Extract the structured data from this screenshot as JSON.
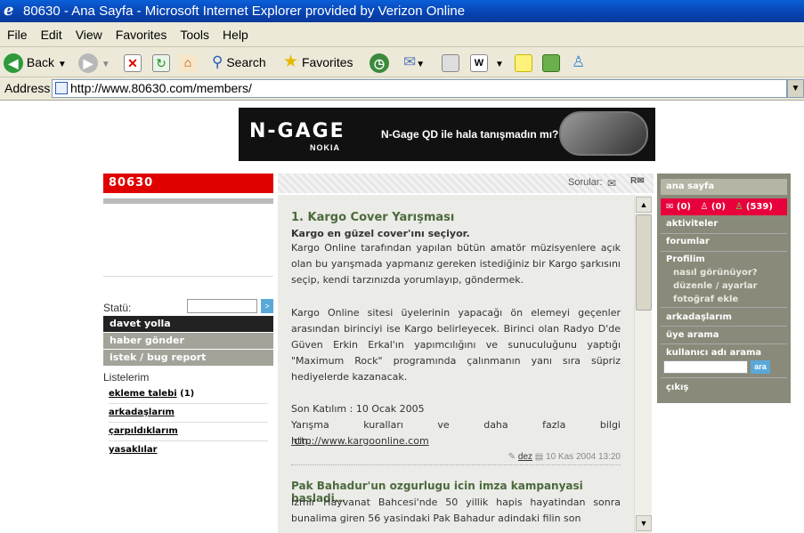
{
  "window": {
    "title": "80630 - Ana Sayfa - Microsoft Internet Explorer provided by Verizon Online"
  },
  "menu": [
    "File",
    "Edit",
    "View",
    "Favorites",
    "Tools",
    "Help"
  ],
  "toolbar": {
    "back": "Back",
    "search": "Search",
    "favorites": "Favorites"
  },
  "address": {
    "label": "Address",
    "url": "http://www.80630.com/members/"
  },
  "banner": {
    "logo": "N-GAGE",
    "brand": "NOKIA",
    "text": "N-Gage QD ile hala tanışmadın mı?"
  },
  "left": {
    "site_logo": "80630",
    "statu_label": "Statü:",
    "statu_btn": ">",
    "nav": [
      "davet yolla",
      "haber gönder",
      "istek / bug report"
    ],
    "listelerim": "Listelerim",
    "lists": [
      {
        "label": "ekleme talebi",
        "count": "(1)"
      },
      {
        "label": "arkadaşlarım",
        "count": ""
      },
      {
        "label": "çarpıldıklarım",
        "count": ""
      },
      {
        "label": "yasaklılar",
        "count": ""
      }
    ]
  },
  "center": {
    "sorular": "Sorular:",
    "articles": [
      {
        "title": "1. Kargo Cover Yarışması",
        "subtitle": "Kargo en güzel cover'ını seçiyor.",
        "p1": "Kargo Online tarafından yapılan bütün amatör müzisyenlere açık olan bu yarışmada yapmanız gereken istediğiniz bir Kargo şarkısını seçip, kendi tarzınızda yorumlayıp, göndermek.",
        "p2": "Kargo Online sitesi üyelerinin yapacağı ön elemeyi geçenler arasından birinciyi ise Kargo belirleyecek. Birinci olan Radyo D'de Güven Erkin Erkal'ın yapımcılığını ve sunuculuğunu yaptığı \"Maximum Rock\" programında çalınmanın yanı sıra süpriz hediyelerde kazanacak.",
        "p3": "Son Katılım : 10 Ocak 2005",
        "p4": "Yarışma kuralları ve daha fazla bilgi için:",
        "link": "http://www.kargoonline.com",
        "author": "dez",
        "date": "10 Kas 2004 13:20"
      },
      {
        "title": "Pak Bahadur'un ozgurlugu icin imza kampanyasi basladi…",
        "p1": "Izmir Hayvanat Bahcesi'nde 50 yillik hapis hayatindan sonra bunalima giren 56 yasindaki Pak Bahadur adindaki filin son"
      }
    ]
  },
  "right": {
    "anasayfa": "ana sayfa",
    "msg_count": "(0)",
    "user_count": "(0)",
    "online_count": "(539)",
    "items": [
      "aktiviteler",
      "forumlar"
    ],
    "profilim": "Profilim",
    "profil_sub": [
      "nasıl görünüyor?",
      "düzenle / ayarlar",
      "fotoğraf ekle"
    ],
    "items2": [
      "arkadaşlarım",
      "üye arama"
    ],
    "search_label": "kullanıcı adı arama",
    "search_btn": "ara",
    "exit": "çıkış"
  }
}
